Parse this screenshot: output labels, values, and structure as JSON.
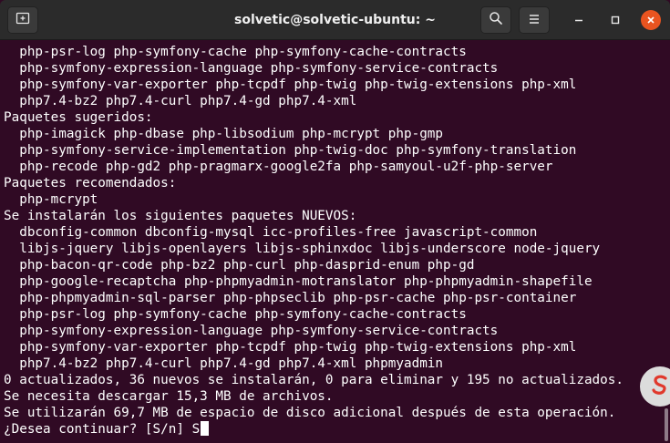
{
  "window": {
    "title": "solvetic@solvetic-ubuntu: ~"
  },
  "icons": {
    "new_tab": "new-tab-icon",
    "search": "search-icon",
    "menu": "hamburger-menu-icon",
    "minimize": "minimize-icon",
    "maximize": "maximize-icon",
    "close": "close-icon",
    "watermark": "logo-icon"
  },
  "colors": {
    "terminal_bg": "#300a24",
    "titlebar_bg": "#2b2b2b",
    "close_button": "#e95420",
    "text": "#ffffff"
  },
  "terminal": {
    "lines": [
      "  php-psr-log php-symfony-cache php-symfony-cache-contracts",
      "  php-symfony-expression-language php-symfony-service-contracts",
      "  php-symfony-var-exporter php-tcpdf php-twig php-twig-extensions php-xml",
      "  php7.4-bz2 php7.4-curl php7.4-gd php7.4-xml",
      "Paquetes sugeridos:",
      "  php-imagick php-dbase php-libsodium php-mcrypt php-gmp",
      "  php-symfony-service-implementation php-twig-doc php-symfony-translation",
      "  php-recode php-gd2 php-pragmarx-google2fa php-samyoul-u2f-php-server",
      "Paquetes recomendados:",
      "  php-mcrypt",
      "Se instalarán los siguientes paquetes NUEVOS:",
      "  dbconfig-common dbconfig-mysql icc-profiles-free javascript-common",
      "  libjs-jquery libjs-openlayers libjs-sphinxdoc libjs-underscore node-jquery",
      "  php-bacon-qr-code php-bz2 php-curl php-dasprid-enum php-gd",
      "  php-google-recaptcha php-phpmyadmin-motranslator php-phpmyadmin-shapefile",
      "  php-phpmyadmin-sql-parser php-phpseclib php-psr-cache php-psr-container",
      "  php-psr-log php-symfony-cache php-symfony-cache-contracts",
      "  php-symfony-expression-language php-symfony-service-contracts",
      "  php-symfony-var-exporter php-tcpdf php-twig php-twig-extensions php-xml",
      "  php7.4-bz2 php7.4-curl php7.4-gd php7.4-xml phpmyadmin",
      "0 actualizados, 36 nuevos se instalarán, 0 para eliminar y 195 no actualizados.",
      "Se necesita descargar 15,3 MB de archivos.",
      "Se utilizarán 69,7 MB de espacio de disco adicional después de esta operación.",
      "¿Desea continuar? [S/n] S"
    ]
  }
}
